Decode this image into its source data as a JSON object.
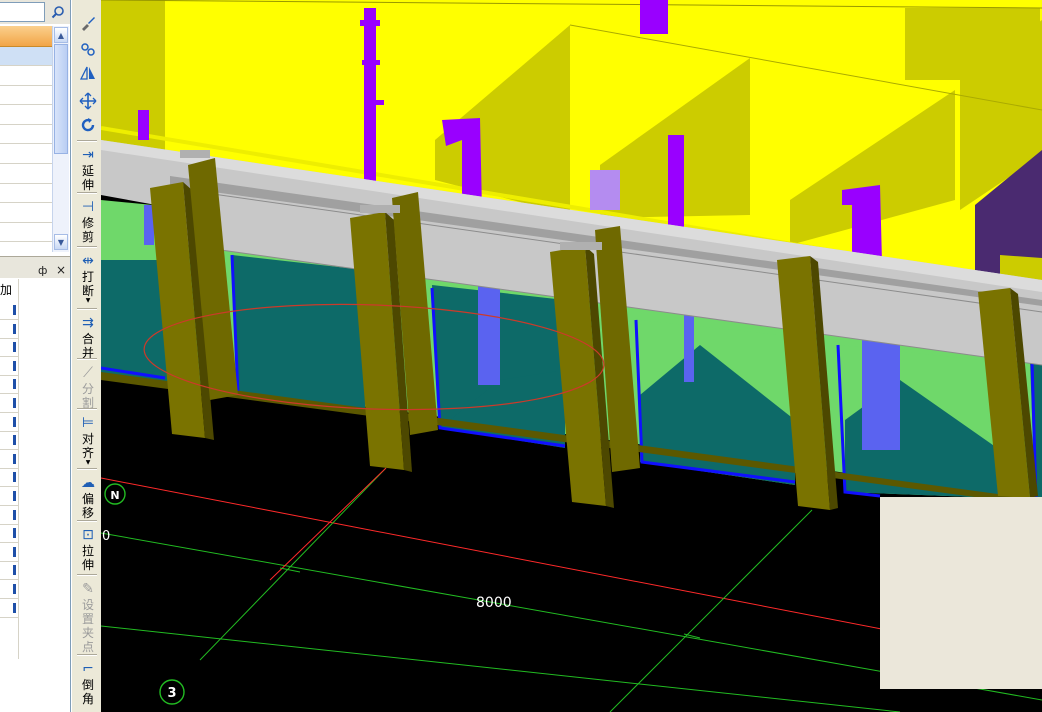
{
  "left_panel": {
    "search": {
      "value": "",
      "icon": "magnifier-icon"
    },
    "list": {
      "rows": 10,
      "scrollbar": {
        "up": "▲",
        "down": "▼"
      }
    },
    "properties": {
      "pin_icon": "ф",
      "close_icon": "×",
      "header_label": "加",
      "rows": 17
    }
  },
  "toolbar": {
    "icon_tools": [
      "brush-icon",
      "copy-icon",
      "mirror-icon",
      "move-icon",
      "rotate-icon"
    ],
    "buttons": [
      {
        "id": "extend",
        "label": "延伸",
        "icon": "extend-icon",
        "has_arrow": false,
        "disabled": false
      },
      {
        "id": "trim",
        "label": "修剪",
        "icon": "trim-icon",
        "has_arrow": false,
        "disabled": false
      },
      {
        "id": "break",
        "label": "打断",
        "icon": "break-icon",
        "has_arrow": true,
        "disabled": false
      },
      {
        "id": "merge",
        "label": "合并",
        "icon": "merge-icon",
        "has_arrow": false,
        "disabled": false
      },
      {
        "id": "split",
        "label": "分割",
        "icon": "split-icon",
        "has_arrow": false,
        "disabled": true
      },
      {
        "id": "align",
        "label": "对齐",
        "icon": "align-icon",
        "has_arrow": true,
        "disabled": false
      },
      {
        "id": "offset",
        "label": "偏移",
        "icon": "offset-icon",
        "has_arrow": false,
        "disabled": false
      },
      {
        "id": "stretch",
        "label": "拉伸",
        "icon": "stretch-icon",
        "has_arrow": false,
        "disabled": false
      },
      {
        "id": "set_grip",
        "label": "设置夹点",
        "icon": "grip-icon",
        "has_arrow": false,
        "disabled": true
      },
      {
        "id": "chamfer",
        "label": "倒角",
        "icon": "chamfer-icon",
        "has_arrow": false,
        "disabled": false
      }
    ]
  },
  "viewport": {
    "axis_labels": {
      "row_axis": "N",
      "column_axis": "3",
      "dimension": "8000",
      "left_cut": "0"
    },
    "colors": {
      "background": "#000000",
      "wall_yellow": "#ffff00",
      "wall_shade": "#cccc00",
      "beam": "#c8c8c8",
      "column": "#7a7300",
      "glass_teal": "#0d6a68",
      "glass_green": "#6fd86a",
      "frame_blue": "#1010ff",
      "pipe_purple": "#9900ff",
      "pipe_blue": "#5a63f0",
      "axis_red": "#ff2a2a",
      "axis_green": "#22bb22",
      "selection_ellipse": "#cc3a2a"
    }
  }
}
